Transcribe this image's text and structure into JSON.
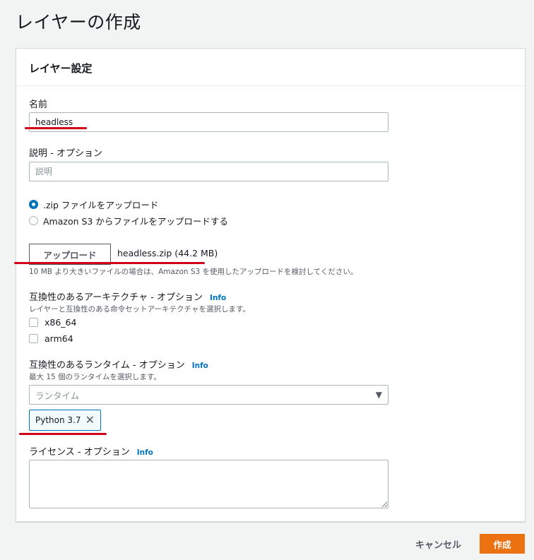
{
  "page": {
    "title": "レイヤーの作成"
  },
  "panel": {
    "header": "レイヤー設定",
    "name": {
      "label": "名前",
      "value": "headless"
    },
    "description": {
      "label": "説明 - オプション",
      "placeholder": "説明"
    },
    "upload_options": [
      {
        "label": ".zip ファイルをアップロード",
        "selected": true
      },
      {
        "label": "Amazon S3 からファイルをアップロードする",
        "selected": false
      }
    ],
    "upload": {
      "button_label": "アップロード",
      "file_name": "headless.zip (44.2 MB)",
      "hint": "10 MB より大きいファイルの場合は、Amazon S3 を使用したアップロードを検討してください。"
    },
    "architectures": {
      "label": "互換性のあるアーキテクチャ - オプション",
      "info": "Info",
      "description": "レイヤーと互換性のある命令セットアーキテクチャを選択します。",
      "options": [
        {
          "label": "x86_64",
          "checked": false
        },
        {
          "label": "arm64",
          "checked": false
        }
      ]
    },
    "runtimes": {
      "label": "互換性のあるランタイム - オプション",
      "info": "Info",
      "description": "最大 15 個のランタイムを選択します。",
      "placeholder": "ランタイム",
      "selected": [
        "Python 3.7"
      ]
    },
    "license": {
      "label": "ライセンス - オプション",
      "info": "Info",
      "value": ""
    }
  },
  "footer": {
    "cancel_label": "キャンセル",
    "create_label": "作成"
  },
  "colors": {
    "primary_button": "#ec7211",
    "link": "#0073bb",
    "annotation_underline": "#d0021b"
  }
}
